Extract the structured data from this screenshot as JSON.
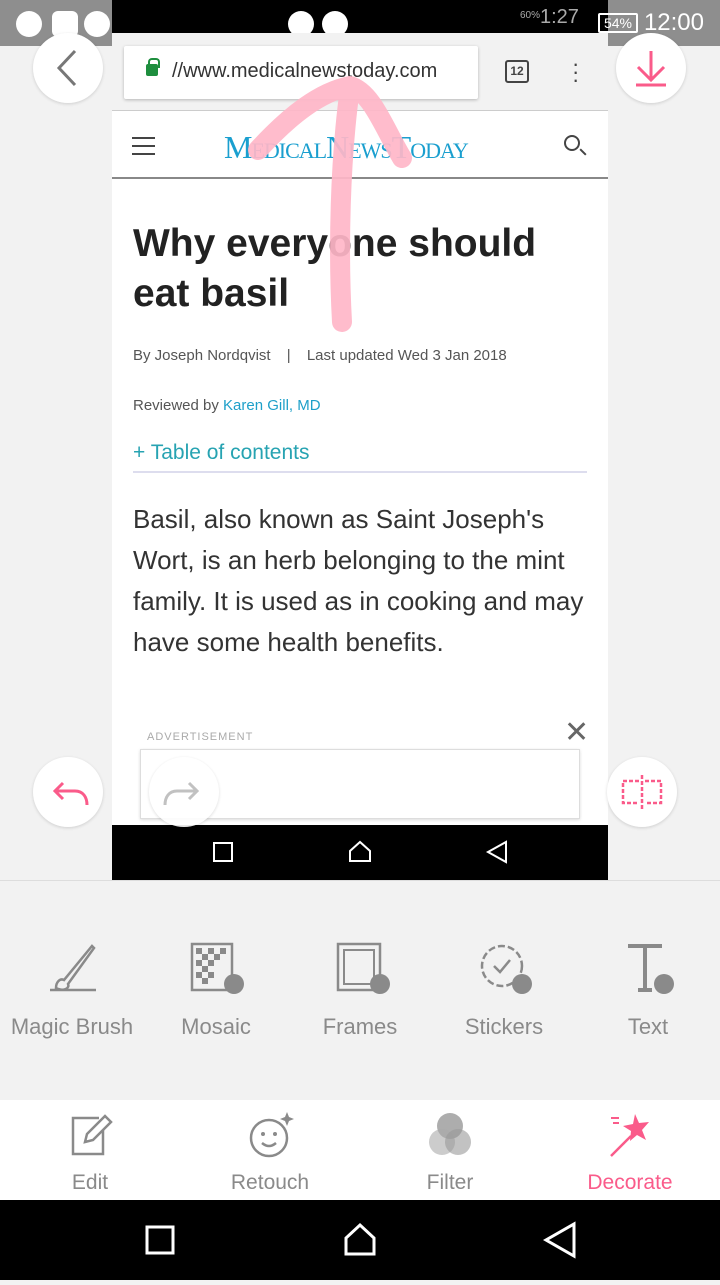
{
  "status_bar": {
    "time": "12:00",
    "battery": "54%",
    "inner_time": "1:27",
    "inner_battery": "60%"
  },
  "browser": {
    "url": "//www.medicalnewstoday.com",
    "tab_count": "12"
  },
  "site": {
    "logo": "MedicalNewsToday"
  },
  "article": {
    "title": "Why everyone should eat basil",
    "byline": "By Joseph Nordqvist",
    "separator": "|",
    "updated": "Last updated Wed 3 Jan 2018",
    "reviewed_prefix": "Reviewed by ",
    "reviewer": "Karen Gill, MD",
    "toc": "+ Table of contents",
    "body": "Basil, also known as Saint Joseph's Wort, is an herb belonging to the mint family. It is used as in cooking and may have some health benefits.",
    "ad_label": "ADVERTISEMENT"
  },
  "annotation": {
    "color": "#ffb6c8",
    "shape": "arrow-up"
  },
  "tools": [
    {
      "label": "Magic Brush",
      "icon": "brush-icon"
    },
    {
      "label": "Mosaic",
      "icon": "mosaic-icon"
    },
    {
      "label": "Frames",
      "icon": "frame-icon"
    },
    {
      "label": "Stickers",
      "icon": "sticker-icon"
    },
    {
      "label": "Text",
      "icon": "text-icon"
    }
  ],
  "tabs": [
    {
      "label": "Edit"
    },
    {
      "label": "Retouch"
    },
    {
      "label": "Filter"
    },
    {
      "label": "Decorate",
      "active": true
    }
  ],
  "colors": {
    "accent": "#fa5b8a",
    "tool_gray": "#8a8a8a",
    "logo": "#1a9fcf"
  }
}
